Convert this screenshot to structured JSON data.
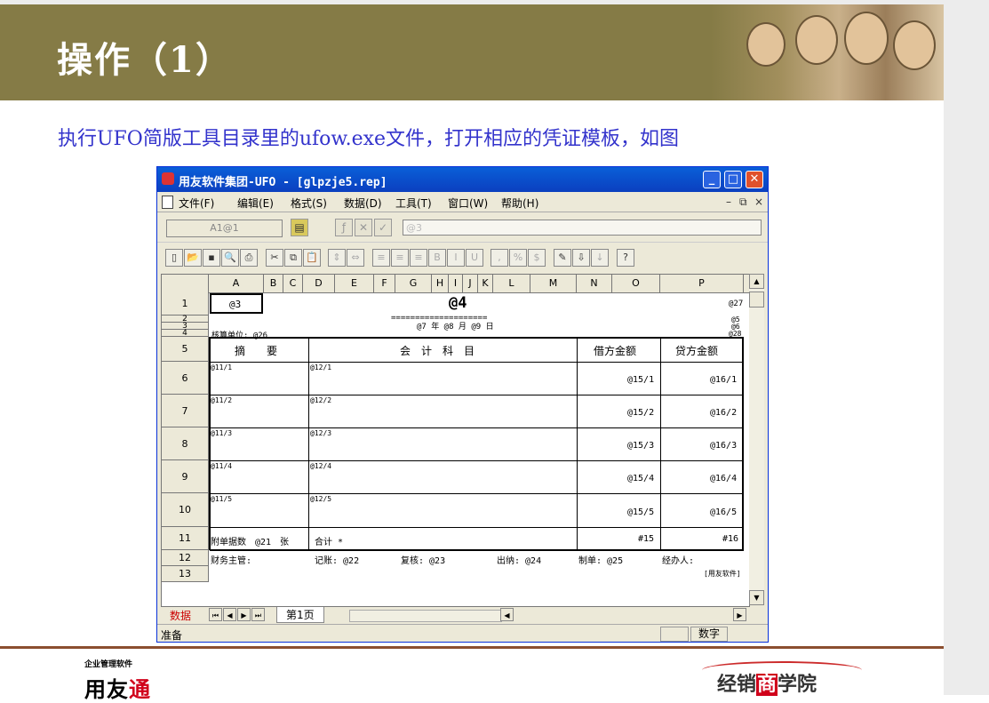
{
  "slide": {
    "title": "操作（1）",
    "subtitle": "执行UFO简版工具目录里的ufow.exe文件，打开相应的凭证模板，如图"
  },
  "window": {
    "title": "用友软件集团-UFO - [glpzje5.rep]",
    "menu": [
      "文件(F)",
      "编辑(E)",
      "格式(S)",
      "数据(D)",
      "工具(T)",
      "窗口(W)",
      "帮助(H)"
    ],
    "cell_ref": "A1@1",
    "formula_value": "@3",
    "status_left": "准备",
    "status_right": "数字",
    "sheet_mode": "数据",
    "sheet_tab": "第1页"
  },
  "sheet": {
    "columns": [
      "A",
      "B",
      "C",
      "D",
      "E",
      "F",
      "G",
      "H",
      "I",
      "J",
      "K",
      "L",
      "M",
      "N",
      "O",
      "P"
    ],
    "rows": [
      "1",
      "2",
      "3",
      "4",
      "5",
      "6",
      "7",
      "8",
      "9",
      "10",
      "11",
      "12",
      "13"
    ],
    "a1": "@3",
    "title": "@4",
    "r1_right": "@27",
    "r2_right": "@5",
    "r3_right": "@6",
    "r4_right": "@28",
    "equals": "====================",
    "date": "@7 年 @8 月 @9 日",
    "unit": "核算单位: @26",
    "header": {
      "summary": "摘　　要",
      "account": "会　计　科　目",
      "debit": "借方金额",
      "credit": "贷方金额"
    },
    "lines": [
      {
        "summary": "@11/1",
        "account": "@12/1",
        "debit": "@15/1",
        "credit": "@16/1"
      },
      {
        "summary": "@11/2",
        "account": "@12/2",
        "debit": "@15/2",
        "credit": "@16/2"
      },
      {
        "summary": "@11/3",
        "account": "@12/3",
        "debit": "@15/3",
        "credit": "@16/3"
      },
      {
        "summary": "@11/4",
        "account": "@12/4",
        "debit": "@15/4",
        "credit": "@16/4"
      },
      {
        "summary": "@11/5",
        "account": "@12/5",
        "debit": "@15/5",
        "credit": "@16/5"
      }
    ],
    "attach": "附单据数　@21　张",
    "total": "合计 *",
    "total_debit": "#15",
    "total_credit": "#16",
    "sign": {
      "chief": "财务主管:",
      "post": "记账: @22",
      "review": "复核: @23",
      "cashier": "出纳: @24",
      "maker": "制单: @25",
      "handler": "经办人:"
    },
    "brand": "[用友软件]"
  },
  "footer": {
    "small": "企业管理软件",
    "logo_a": "用友",
    "logo_b": "通",
    "right_a": "经销",
    "right_b": "商",
    "right_c": "学院"
  }
}
